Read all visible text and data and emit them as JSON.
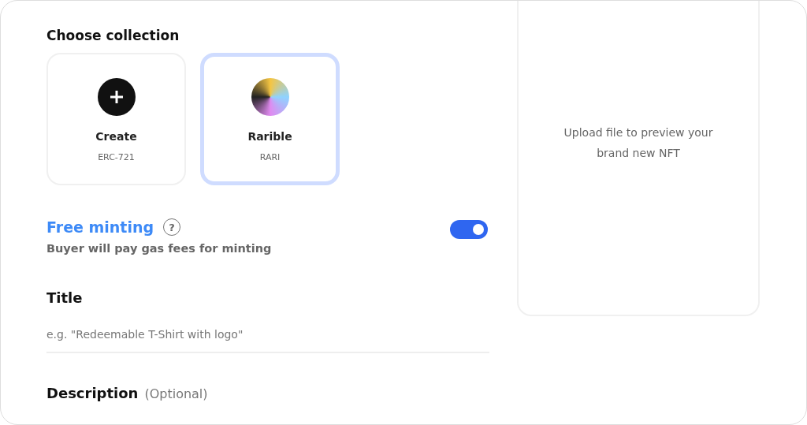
{
  "collection": {
    "heading": "Choose collection",
    "items": [
      {
        "kind": "create",
        "name": "Create",
        "subtitle": "ERC-721",
        "selected": false
      },
      {
        "kind": "logo",
        "name": "Rarible",
        "subtitle": "RARI",
        "selected": true
      }
    ]
  },
  "free_minting": {
    "title": "Free minting",
    "help": "?",
    "description": "Buyer will pay gas fees for minting",
    "on": true
  },
  "title_field": {
    "label": "Title",
    "placeholder": "e.g. \"Redeemable T-Shirt with logo\""
  },
  "description_field": {
    "label": "Description",
    "hint": "(Optional)"
  },
  "preview": {
    "text": "Upload file to preview your brand new NFT"
  }
}
